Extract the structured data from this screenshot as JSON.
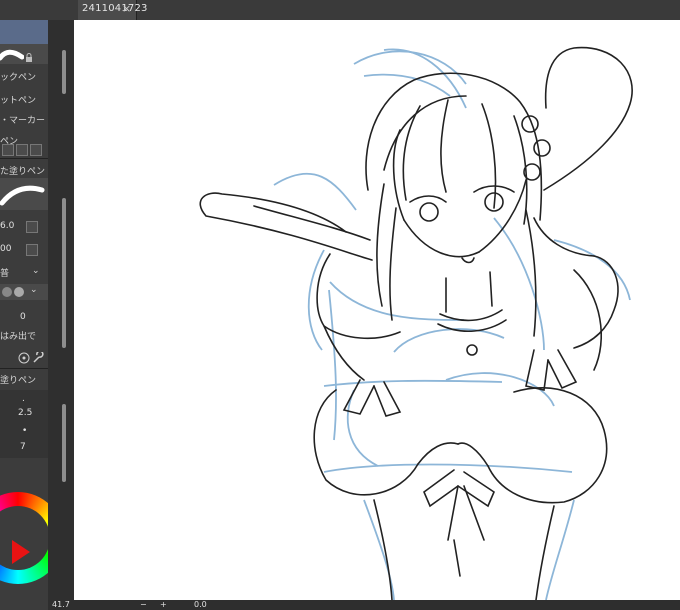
{
  "window": {
    "tab_title": "2411041723",
    "close_glyph": "×"
  },
  "left_panel": {
    "sub_tool_items": [
      "ックペン",
      "ットペン",
      "・マーカー",
      "ペン"
    ],
    "section_label_1": "た塗りペン",
    "size_value": "6.0",
    "opacity_value": "00",
    "mode_label": "普",
    "angle_value": "0",
    "hidden_label": "はみ出で",
    "section_label_2": "塗りペン",
    "step_values": [
      ".",
      "2.5",
      "•",
      "7"
    ]
  },
  "status": {
    "zoom": "41.7",
    "minus": "−",
    "plus": "+",
    "zoom_field": "0.0"
  },
  "colors": {
    "main_color": "#e91313"
  }
}
